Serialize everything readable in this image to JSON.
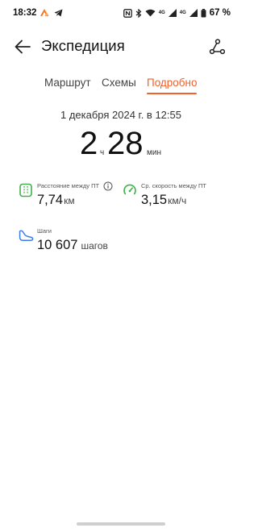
{
  "status_bar": {
    "time": "18:32",
    "battery": "67 %",
    "icons": [
      "strava-icon",
      "telegram-icon",
      "nfc-icon",
      "bluetooth-icon",
      "wifi-icon",
      "signal-icon",
      "battery-icon"
    ],
    "net1": "4G",
    "net2": "4G"
  },
  "app_bar": {
    "title": "Экспедиция"
  },
  "tabs": [
    {
      "label": "Маршрут",
      "selected": false
    },
    {
      "label": "Схемы",
      "selected": false
    },
    {
      "label": "Подробно",
      "selected": true
    }
  ],
  "workout": {
    "date": "1 декабря 2024 г. в 12:55",
    "duration_hours": "2",
    "hours_unit": "ч",
    "duration_minutes": "28",
    "minutes_unit": "мин"
  },
  "metrics": {
    "distance": {
      "label": "Расстояние между ПТ",
      "value": "7,74",
      "unit": "км"
    },
    "speed": {
      "label": "Ср. скорость между ПТ",
      "value": "3,15",
      "unit": "км/ч"
    },
    "steps": {
      "label": "Шаги",
      "value": "10 607",
      "unit": "шагов"
    }
  },
  "colors": {
    "accent": "#f0612b",
    "green": "#3fb24a",
    "blue": "#3b7de6"
  }
}
